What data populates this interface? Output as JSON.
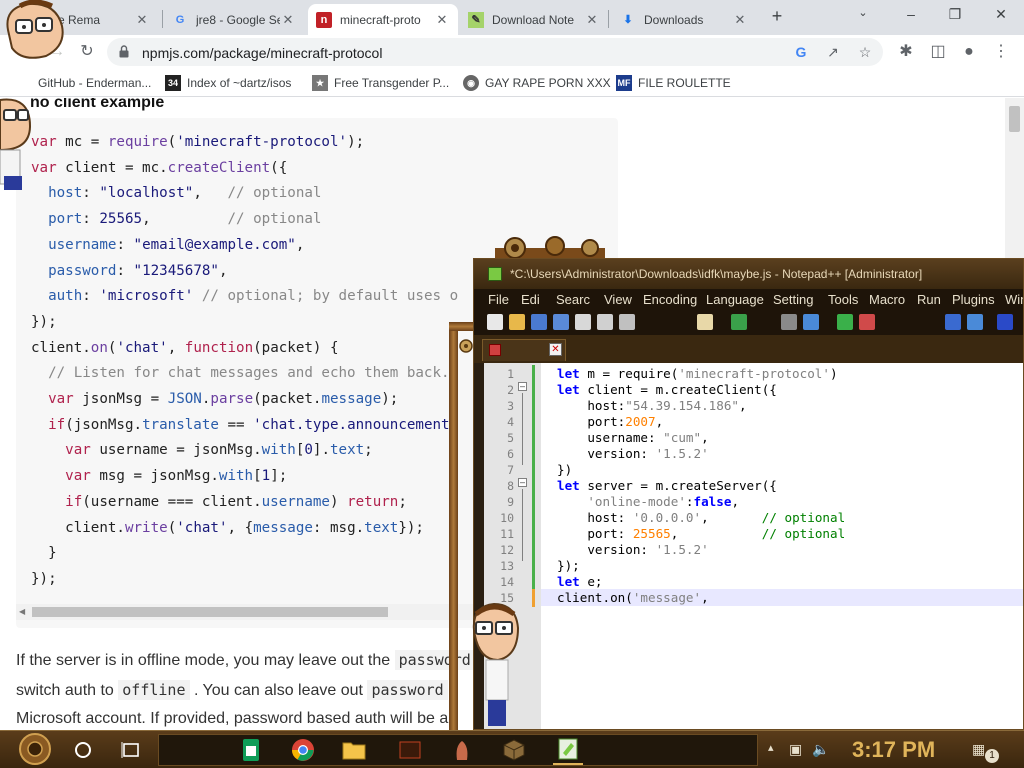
{
  "tabs": [
    {
      "title": "Afire Rema",
      "favicon": "fire-favicon"
    },
    {
      "title": "jre8 - Google Se",
      "favicon": "google-favicon"
    },
    {
      "title": "minecraft-proto",
      "favicon": "npm-favicon",
      "active": true
    },
    {
      "title": "Download Note",
      "favicon": "notepad-favicon"
    },
    {
      "title": "Downloads",
      "favicon": "download-favicon"
    }
  ],
  "address": {
    "url": "npmjs.com/package/minecraft-protocol"
  },
  "bookmarks": [
    {
      "label": "GitHub - Enderman...",
      "icon": "github-icon"
    },
    {
      "label": "Index of ~dartz/isos",
      "icon": "directory-icon"
    },
    {
      "label": "Free Transgender P...",
      "icon": "bookmark-icon"
    },
    {
      "label": "GAY RAPE PORN XXX",
      "icon": "globe-icon"
    },
    {
      "label": "FILE ROULETTE",
      "icon": "file-icon"
    }
  ],
  "page": {
    "heading": "no client example",
    "prose": [
      "If the server is in offline mode, you may leave out the",
      "password",
      "switch auth to",
      "offline",
      ". You can also leave out",
      "password",
      "Microsoft account. If provided, password based auth will be a"
    ]
  },
  "code_lines": [
    "var mc = require('minecraft-protocol');",
    "var client = mc.createClient({",
    "  host: \"localhost\",   // optional",
    "  port: 25565,         // optional",
    "  username: \"email@example.com\",",
    "  password: \"12345678\",",
    "  auth: 'microsoft' // optional; by default uses o",
    "});",
    "client.on('chat', function(packet) {",
    "  // Listen for chat messages and echo them back.",
    "  var jsonMsg = JSON.parse(packet.message);",
    "  if(jsonMsg.translate == 'chat.type.announcement'",
    "    var username = jsonMsg.with[0].text;",
    "    var msg = jsonMsg.with[1];",
    "    if(username === client.username) return;",
    "    client.write('chat', {message: msg.text});",
    "  }",
    "});"
  ],
  "notepad": {
    "title": "*C:\\Users\\Administrator\\Downloads\\idfk\\maybe.js - Notepad++ [Administrator]",
    "menu": [
      "File",
      "Edi",
      "Searc",
      "View",
      "Encoding",
      "Language",
      "Setting",
      "Tools",
      "Macro",
      "Run",
      "Plugins",
      "Win"
    ],
    "tab_label": "",
    "line_numbers": [
      "1",
      "2",
      "3",
      "4",
      "5",
      "6",
      "7",
      "8",
      "9",
      "10",
      "11",
      "12",
      "13",
      "14",
      "15"
    ],
    "code": [
      "let m = require('minecraft-protocol')",
      "let client = m.createClient({",
      "    host:\"54.39.154.186\",",
      "    port:2007,",
      "    username: \"cum\",",
      "    version: '1.5.2'",
      "})",
      "let server = m.createServer({",
      "    'online-mode':false,",
      "    host: '0.0.0.0',       // optional",
      "    port: 25565,           // optional",
      "    version: '1.5.2'",
      "});",
      "let e;",
      "client.on('message',"
    ]
  },
  "taskbar": {
    "clock": "3:17 PM",
    "notification_count": "1"
  },
  "colors": {
    "accent": "#c12127",
    "taskbar": "#3a260e",
    "clock": "#e0b45a"
  }
}
